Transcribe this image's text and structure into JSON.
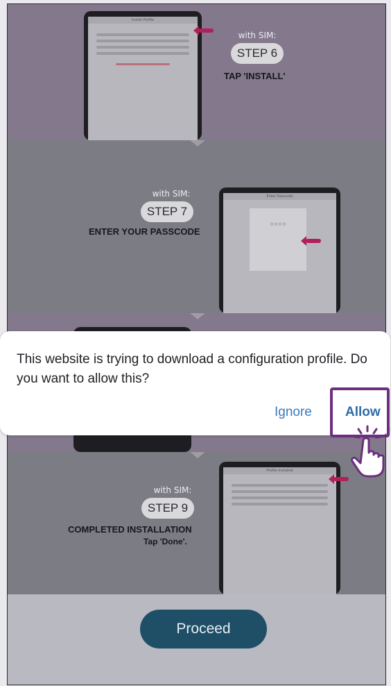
{
  "steps": [
    {
      "with_sim": "with SIM:",
      "step": "STEP 6",
      "instruction": "TAP 'INSTALL'",
      "screen_title": "Install Profile"
    },
    {
      "with_sim": "with SIM:",
      "step": "STEP 7",
      "instruction": "ENTER YOUR PASSCODE",
      "screen_title": "Enter Passcode"
    },
    {
      "with_sim": "with SIM:",
      "step": "STEP 9",
      "instruction": "COMPLETED INSTALLATION",
      "note": "Tap 'Done'.",
      "screen_title": "Profile Installed"
    }
  ],
  "dialog": {
    "message": "This website is trying to download a configuration profile. Do you want to allow this?",
    "ignore_label": "Ignore",
    "allow_label": "Allow"
  },
  "proceed_label": "Proceed",
  "colors": {
    "accent_purple": "#6c2f7f",
    "button_teal": "#1e4f66",
    "link_blue": "#3a7bbd",
    "arrow_red": "#b0205a"
  },
  "icons": [
    "tap-hand-icon",
    "arrow-indicator-icon"
  ]
}
